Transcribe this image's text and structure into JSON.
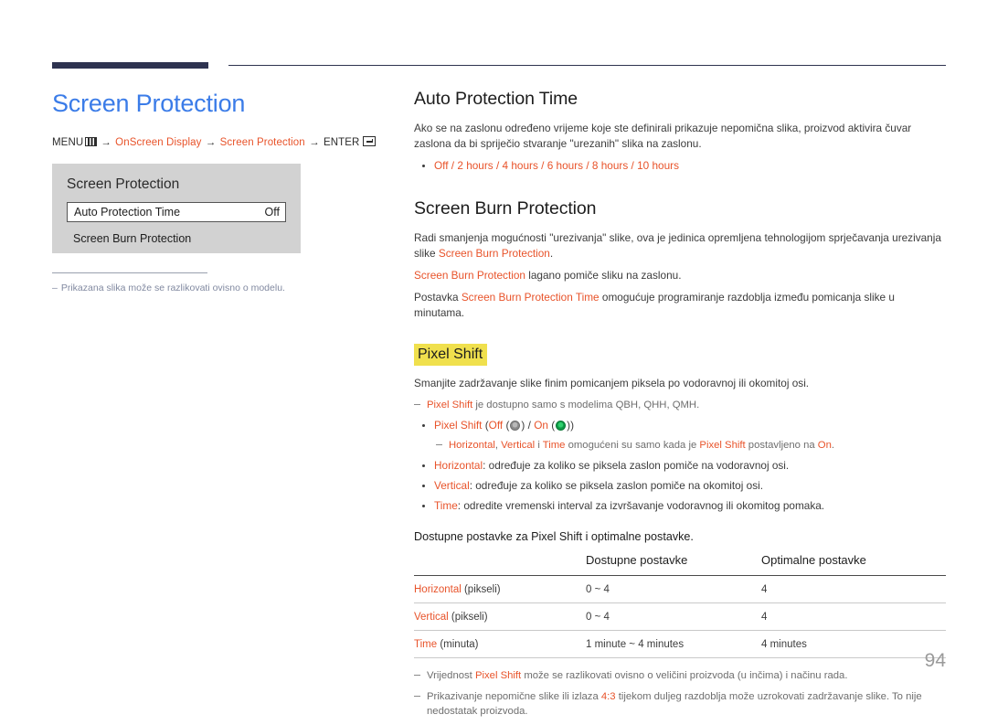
{
  "header": {
    "bar_color": "#2e3350",
    "rule_color": "#2e3350"
  },
  "left": {
    "page_title": "Screen Protection",
    "menu_path": {
      "menu_label": "MENU",
      "menu_icon": "menu-grid-icon",
      "arrow1": "→",
      "item1": "OnScreen Display",
      "arrow2": "→",
      "item2": "Screen Protection",
      "arrow3": "→",
      "enter_label": "ENTER",
      "enter_icon": "enter-key-icon"
    },
    "osd": {
      "title": "Screen Protection",
      "rows": [
        {
          "label": "Auto Protection Time",
          "value": "Off",
          "selected": true
        },
        {
          "label": "Screen Burn Protection",
          "value": "",
          "selected": false
        }
      ]
    },
    "note": {
      "dash": "–",
      "text": "Prikazana slika može se razlikovati ovisno o modelu."
    }
  },
  "right": {
    "section1": {
      "heading": "Auto Protection Time",
      "paragraph": "Ako se na zaslonu određeno vrijeme koje ste definirali prikazuje nepomična slika, proizvod aktivira čuvar zaslona da bi spriječio stvaranje \"urezanih\" slika na zaslonu.",
      "options": "Off / 2 hours / 4 hours / 6 hours / 8 hours / 10 hours"
    },
    "section2": {
      "heading": "Screen Burn Protection",
      "p1_prefix": "Radi smanjenja mogućnosti \"urezivanja\" slike, ova je jedinica opremljena tehnologijom sprječavanja urezivanja slike ",
      "p1_accent": "Screen Burn Protection",
      "p1_suffix": ".",
      "p2_accent": "Screen Burn Protection",
      "p2_suffix": " lagano pomiče sliku na zaslonu.",
      "p3_prefix": "Postavka ",
      "p3_accent": "Screen Burn Protection Time",
      "p3_suffix": " omogućuje programiranje razdoblja između pomicanja slike u minutama."
    },
    "pixel_shift": {
      "heading": "Pixel Shift",
      "highlight_color": "#f0e04d",
      "intro": "Smanjite zadržavanje slike finim pomicanjem piksela po vodoravnoj ili okomitoj osi.",
      "note_models_accent": "Pixel Shift",
      "note_models_text": " je dostupno samo s modelima QBH, QHH, QMH.",
      "toggle_bullet": {
        "label": "Pixel Shift",
        "open": " (",
        "off_label": "Off",
        "off_icon": "toggle-off-indicator",
        "separator": " / ",
        "on_label": "On",
        "on_icon": "toggle-on-indicator",
        "close": ")"
      },
      "subnote": {
        "a1": "Horizontal",
        "comma": ", ",
        "a2": "Vertical",
        "mid": " i ",
        "a3": "Time",
        "text1": " omogućeni su samo kada je ",
        "a4": "Pixel Shift",
        "text2": " postavljeno na ",
        "a5": "On",
        "period": "."
      },
      "items": [
        {
          "term": "Horizontal",
          "desc": ": određuje za koliko se piksela zaslon pomiče na vodoravnoj osi."
        },
        {
          "term": "Vertical",
          "desc": ": određuje za koliko se piksela zaslon pomiče na okomitoj osi."
        },
        {
          "term": "Time",
          "desc": ": odredite vremenski interval za izvršavanje vodoravnog ili okomitog pomaka."
        }
      ]
    },
    "table_lead": "Dostupne postavke za Pixel Shift i optimalne postavke.",
    "table": {
      "headers": [
        "",
        "Dostupne postavke",
        "Optimalne postavke"
      ],
      "rows": [
        {
          "term": "Horizontal",
          "unit": " (pikseli)",
          "available": "0 ~ 4",
          "optimal": "4"
        },
        {
          "term": "Vertical",
          "unit": " (pikseli)",
          "available": "0 ~ 4",
          "optimal": "4"
        },
        {
          "term": "Time",
          "unit": " (minuta)",
          "available": "1 minute ~ 4 minutes",
          "optimal": "4 minutes"
        }
      ]
    },
    "footnotes": [
      {
        "prefix": "Vrijednost ",
        "accent": "Pixel Shift",
        "suffix": " može se razlikovati ovisno o veličini proizvoda (u inčima) i načinu rada."
      },
      {
        "prefix": "Prikazivanje nepomične slike ili izlaza ",
        "accent": "4:3",
        "suffix": " tijekom duljeg razdoblja može uzrokovati zadržavanje slike. To nije nedostatak proizvoda."
      }
    ]
  },
  "page_number": "94",
  "colors": {
    "accent": "#e8532a",
    "title_blue": "#3b7ce8",
    "highlight_yellow": "#f0e04d",
    "navy": "#2e3350"
  }
}
